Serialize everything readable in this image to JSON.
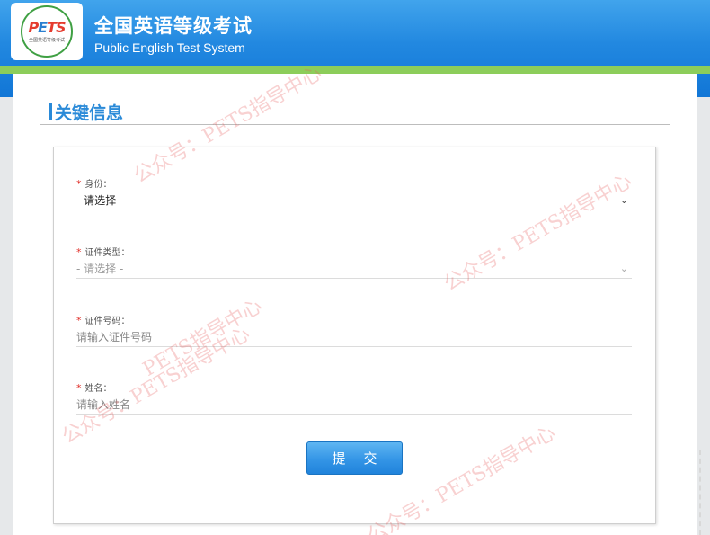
{
  "header": {
    "logo_text": "PETS",
    "logo_sub": "全国英语等级考试",
    "title": "全国英语等级考试",
    "subtitle": "Public English Test System"
  },
  "section": {
    "title": "关键信息"
  },
  "form": {
    "required_mark": "*",
    "fields": [
      {
        "label": "身份：",
        "value": "- 请选择 -",
        "type": "select",
        "icon": "chevron-down-icon"
      },
      {
        "label": "证件类型：",
        "value": "- 请选择 -",
        "type": "select",
        "icon": "chevron-down-icon"
      },
      {
        "label": "证件号码：",
        "placeholder": "请输入证件号码",
        "type": "input"
      },
      {
        "label": "姓名：",
        "placeholder": "请输入姓名",
        "type": "input"
      }
    ],
    "submit_label": "提交"
  },
  "watermark": {
    "text_a": "公众号：PETS指导中心",
    "text_b": "公众号：PETS指导中心",
    "text_c": "PETS指导中心",
    "text_d": "公众号：PETS指导中心",
    "text_e": "公众号：PETS指导中心"
  },
  "colors": {
    "header_blue": "#2288e0",
    "header_green": "#8ccd5a",
    "accent": "#2a8ad8",
    "required": "#e0302a"
  }
}
